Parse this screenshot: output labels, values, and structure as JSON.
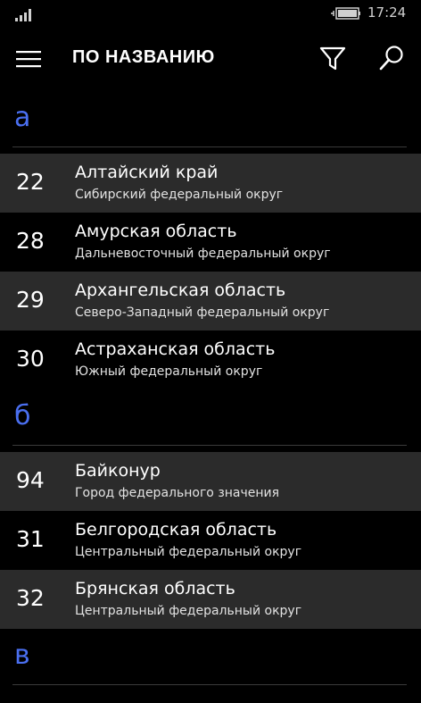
{
  "status_bar": {
    "time": "17:24",
    "signal_icon": "signal-bars-icon",
    "battery_icon": "battery-charging-icon"
  },
  "app_bar": {
    "title": "ПО НАЗВАНИЮ",
    "menu_icon": "hamburger-menu-icon",
    "filter_icon": "filter-funnel-icon",
    "search_icon": "search-icon"
  },
  "colors": {
    "accent": "#4a6ff0",
    "background": "#000000",
    "alt_row": "#2b2b2b"
  },
  "groups": [
    {
      "letter": "а",
      "items": [
        {
          "code": "22",
          "name": "Алтайский край",
          "district": "Сибирский федеральный округ"
        },
        {
          "code": "28",
          "name": "Амурская область",
          "district": "Дальневосточный федеральный округ"
        },
        {
          "code": "29",
          "name": "Архангельская область",
          "district": "Северо-Западный федеральный округ"
        },
        {
          "code": "30",
          "name": "Астраханская область",
          "district": "Южный федеральный округ"
        }
      ]
    },
    {
      "letter": "б",
      "items": [
        {
          "code": "94",
          "name": "Байконур",
          "district": "Город федерального значения"
        },
        {
          "code": "31",
          "name": "Белгородская область",
          "district": "Центральный федеральный округ"
        },
        {
          "code": "32",
          "name": "Брянская область",
          "district": "Центральный федеральный округ"
        }
      ]
    },
    {
      "letter": "в",
      "items": []
    }
  ]
}
